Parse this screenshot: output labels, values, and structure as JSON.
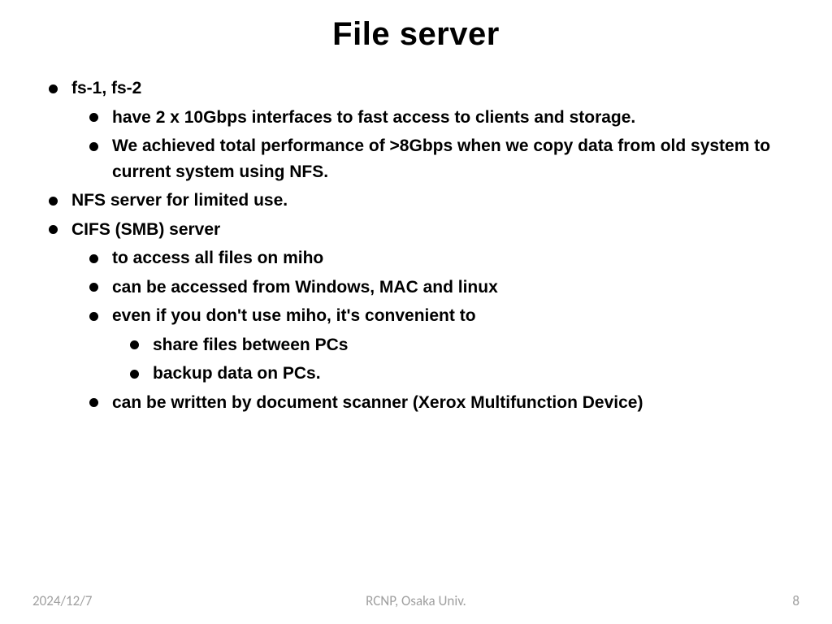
{
  "title": "File server",
  "bullets": {
    "b1": "fs-1, fs-2",
    "b1_1": "have  2 x 10Gbps interfaces to fast access to clients and storage.",
    "b1_2": "We achieved total performance of  >8Gbps when we copy data from old system to current system using NFS.",
    "b2": "NFS server for limited use.",
    "b3": "CIFS (SMB)  server",
    "b3_1": "to access all files on miho",
    "b3_2": "can be accessed from Windows, MAC and linux",
    "b3_3": "even  if you don't use miho, it's convenient to",
    "b3_3_1": "share files between PCs",
    "b3_3_2": "backup data on PCs.",
    "b3_4": "can be written by document scanner (Xerox Multifunction Device)"
  },
  "footer": {
    "date": "2024/12/7",
    "org": "RCNP, Osaka Univ.",
    "page": "8"
  }
}
